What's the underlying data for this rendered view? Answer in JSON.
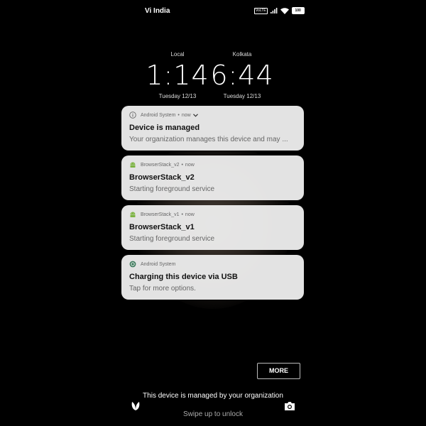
{
  "status_bar": {
    "carrier": "Vi India",
    "volte": "VoLTE",
    "battery": "100"
  },
  "clocks": [
    {
      "label": "Local",
      "time": "1:14",
      "date": "Tuesday 12/13"
    },
    {
      "label": "Kolkata",
      "time": "6:44",
      "date": "Tuesday 12/13"
    }
  ],
  "notifications": [
    {
      "app": "Android System",
      "time": "now",
      "title": "Device is managed",
      "text": "Your organization manages this device and may ...",
      "icon": "info-icon"
    },
    {
      "app": "BrowserStack_v2",
      "time": "now",
      "title": "BrowserStack_v2",
      "text": "Starting foreground service",
      "icon": "android-icon"
    },
    {
      "app": "BrowserStack_v1",
      "time": "now",
      "title": "BrowserStack_v1",
      "text": "Starting foreground service",
      "icon": "android-icon"
    },
    {
      "app": "Android System",
      "title": "Charging this device via USB",
      "text": "Tap for more options.",
      "icon": "usb-icon"
    }
  ],
  "more_button": "MORE",
  "managed_message": "This device is managed by your organization",
  "swipe_hint": "Swipe up to unlock",
  "colors": {
    "background": "#000000",
    "card": "#ececec",
    "android_green": "#7cb342"
  }
}
